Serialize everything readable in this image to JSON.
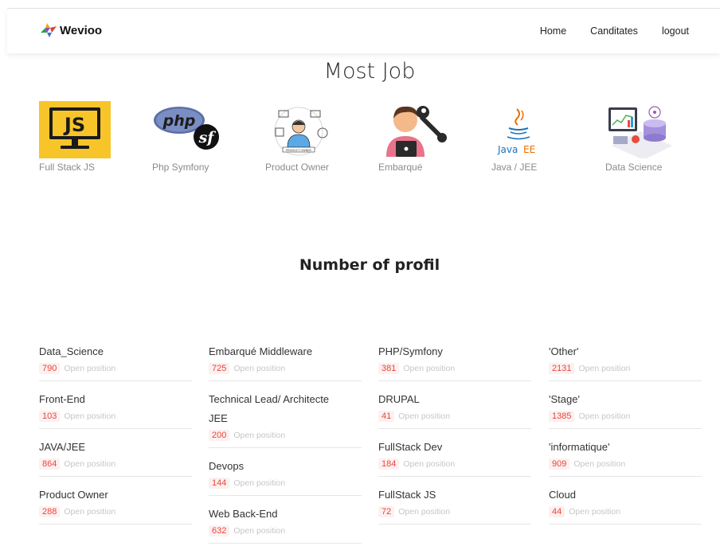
{
  "nav": {
    "brand": "Wevioo",
    "links": [
      "Home",
      "Canditates",
      "logout"
    ]
  },
  "most_job": {
    "title": "Most Job",
    "jobs": [
      {
        "label": "Full Stack JS",
        "icon": "js-monitor-icon"
      },
      {
        "label": "Php Symfony",
        "icon": "php-symfony-icon"
      },
      {
        "label": "Product Owner",
        "icon": "product-owner-icon"
      },
      {
        "label": "Embarqué",
        "icon": "engineer-wrench-icon"
      },
      {
        "label": "Java / JEE",
        "icon": "java-ee-icon"
      },
      {
        "label": "Data Science",
        "icon": "data-science-icon"
      }
    ]
  },
  "profil": {
    "title": "Number of profil",
    "open_label": "Open position",
    "columns": [
      [
        {
          "name": "Data_Science",
          "count": "790"
        },
        {
          "name": "Front-End",
          "count": "103"
        },
        {
          "name": "JAVA/JEE",
          "count": "864"
        },
        {
          "name": "Product Owner",
          "count": "288"
        }
      ],
      [
        {
          "name": "Embarqué Middleware",
          "count": "725"
        },
        {
          "name": "Technical Lead/ Architecte JEE",
          "count": "200"
        },
        {
          "name": "Devops",
          "count": "144"
        },
        {
          "name": "Web Back-End",
          "count": "632"
        }
      ],
      [
        {
          "name": "PHP/Symfony",
          "count": "381"
        },
        {
          "name": "DRUPAL",
          "count": "41"
        },
        {
          "name": "FullStack Dev",
          "count": "184"
        },
        {
          "name": "FullStack JS",
          "count": "72"
        }
      ],
      [
        {
          "name": "'Other'",
          "count": "2131"
        },
        {
          "name": "'Stage'",
          "count": "1385"
        },
        {
          "name": "'informatique'",
          "count": "909"
        },
        {
          "name": "Cloud",
          "count": "44"
        }
      ]
    ]
  },
  "colors": {
    "accent_red": "#e8473b",
    "badge_bg": "#fdf0f0",
    "js_yellow": "#f7c52a"
  }
}
